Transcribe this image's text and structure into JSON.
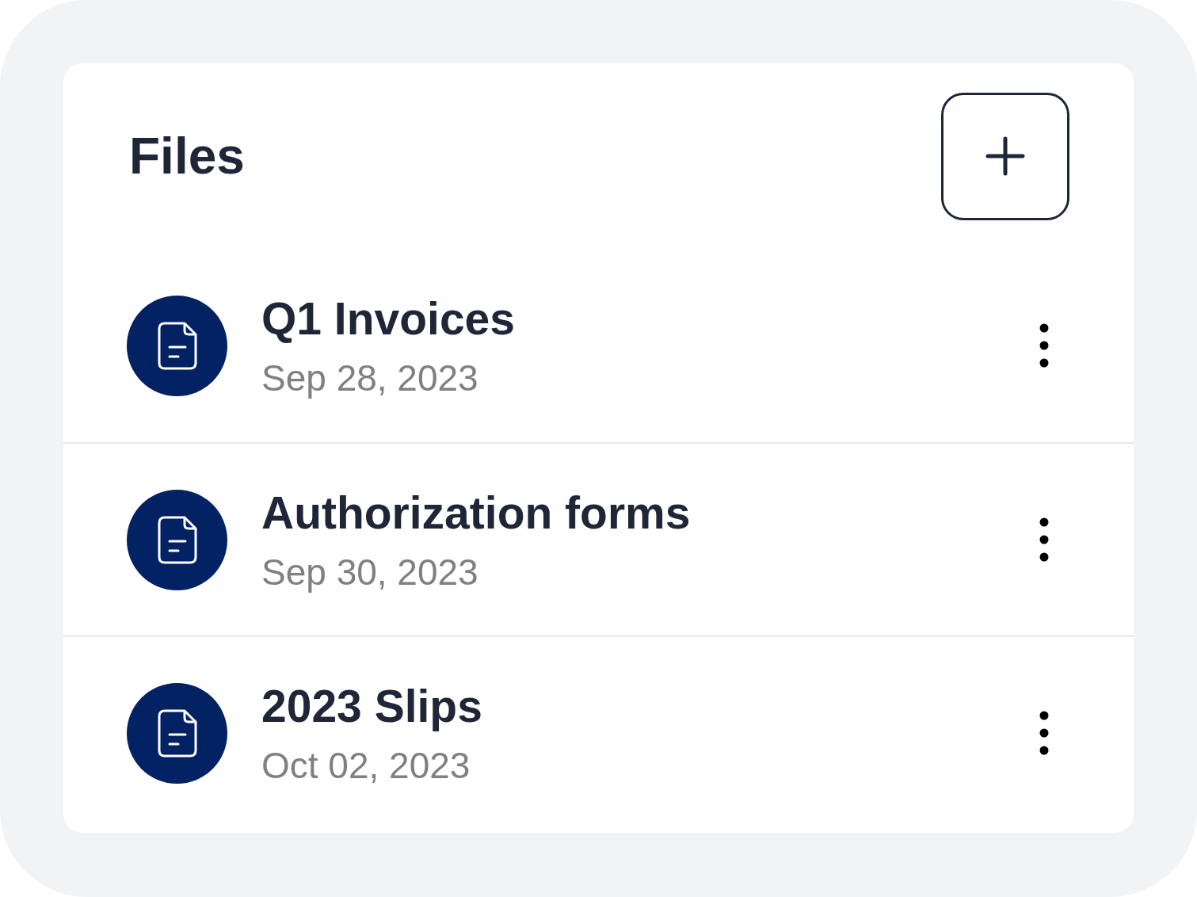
{
  "header": {
    "title": "Files"
  },
  "files": [
    {
      "name": "Q1 Invoices",
      "date": "Sep 28, 2023"
    },
    {
      "name": "Authorization forms",
      "date": "Sep 30, 2023"
    },
    {
      "name": "2023 Slips",
      "date": "Oct 02, 2023"
    }
  ]
}
